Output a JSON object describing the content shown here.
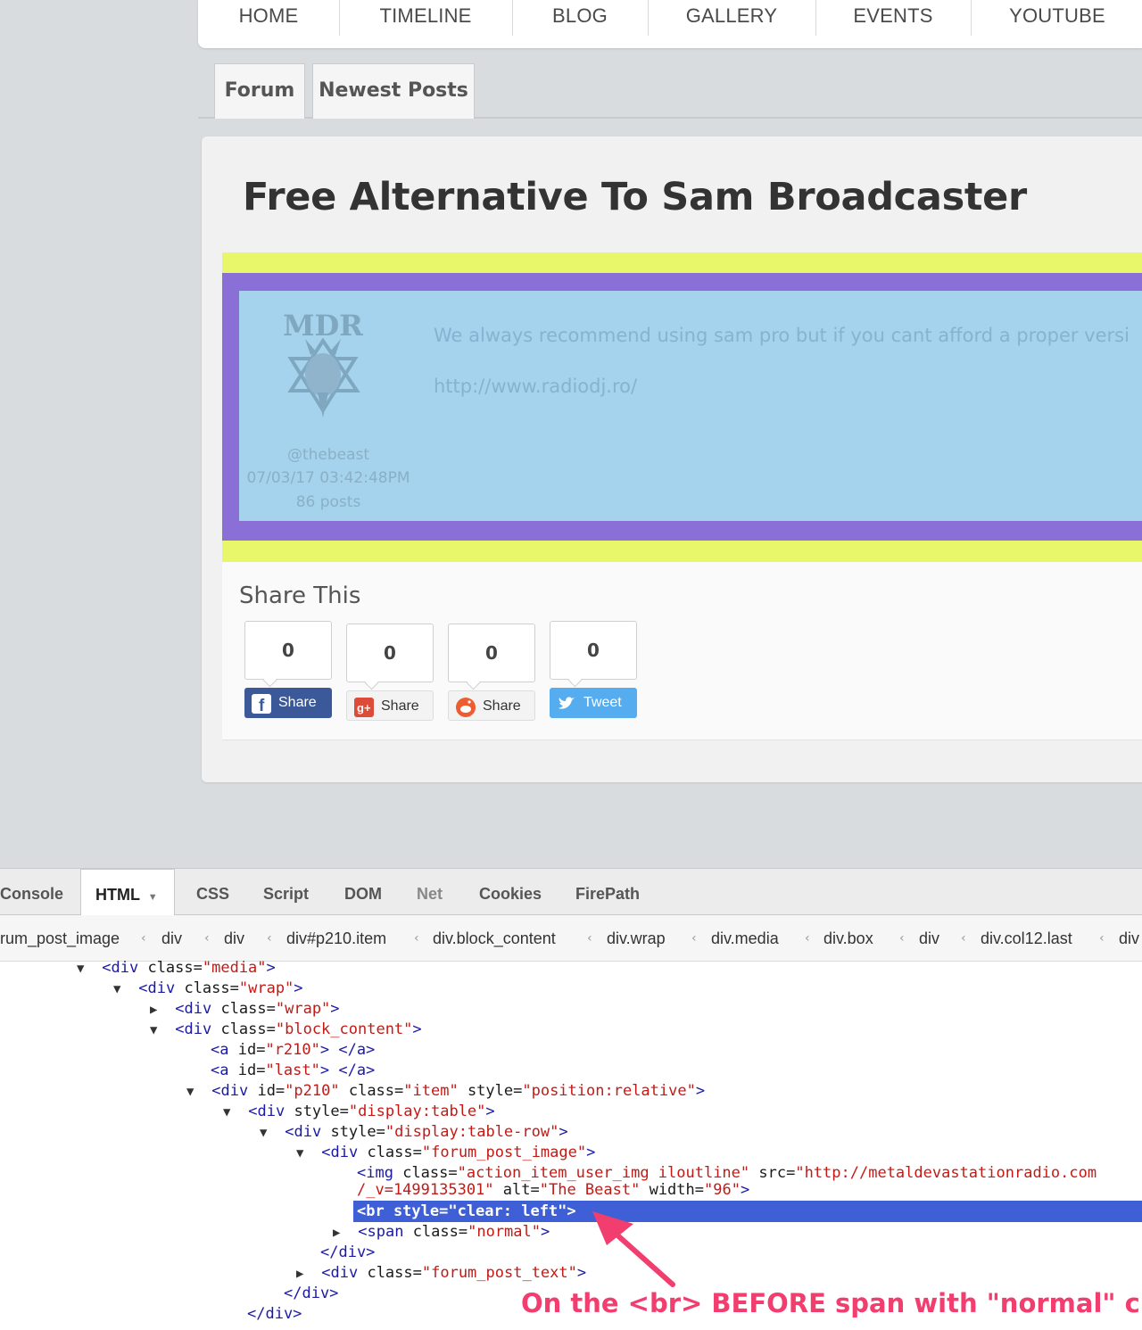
{
  "nav": {
    "items": [
      "HOME",
      "TIMELINE",
      "BLOG",
      "GALLERY",
      "EVENTS",
      "YOUTUBE"
    ]
  },
  "tabs": [
    "Forum",
    "Newest Posts"
  ],
  "post": {
    "title": "Free Alternative To Sam Broadcaster",
    "text_line1": "We always recommend using sam pro but if you cant afford a proper versi",
    "text_line2": "http://www.radiodj.ro/",
    "author": "@thebeast",
    "datetime": "07/03/17 03:42:48PM",
    "posts": "86 posts",
    "avatar_text": "MDR"
  },
  "share": {
    "title": "Share This",
    "buttons": [
      {
        "count": "0",
        "label": "Share",
        "icon": "facebook-icon"
      },
      {
        "count": "0",
        "label": "Share",
        "icon": "google-plus-icon"
      },
      {
        "count": "0",
        "label": "Share",
        "icon": "reddit-icon"
      },
      {
        "count": "0",
        "label": "Tweet",
        "icon": "twitter-icon"
      }
    ]
  },
  "devtools": {
    "tabs": [
      "Console",
      "HTML",
      "CSS",
      "Script",
      "DOM",
      "Net",
      "Cookies",
      "FirePath"
    ],
    "active_tab": "HTML",
    "breadcrumbs": [
      "rum_post_image",
      "div",
      "div",
      "div#p210.item",
      "div.block_content",
      "div.wrap",
      "div.media",
      "div.box",
      "div",
      "div.col12.last",
      "div"
    ],
    "highlighted": "<br style=\"clear: left\">",
    "annotation": "On the <br> BEFORE span with \"normal\" class"
  },
  "colors": {
    "yellow": "#e8f76a",
    "purple": "#8a70d6",
    "blue": "#a5d2ec",
    "highlight": "#3e5fd6",
    "annotation": "#f23d6f"
  }
}
